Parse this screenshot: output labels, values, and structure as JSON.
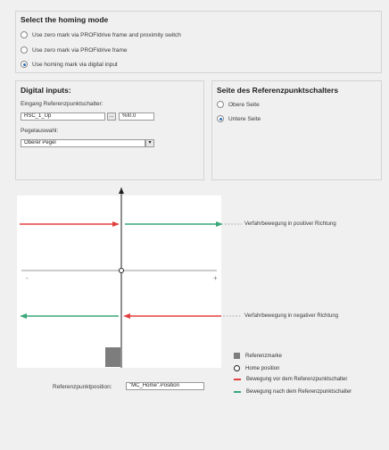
{
  "homing": {
    "title": "Select the homing mode",
    "options": [
      "Use zero mark via PROFIdrive frame and proximity switch",
      "Use zero mark via PROFIdrive frame",
      "Use homing mark via digital input"
    ],
    "selected_index": 2
  },
  "digital_inputs": {
    "title": "Digital inputs:",
    "ref_switch_label": "Eingang Referenzpunktschalter:",
    "ref_switch_value": "HSC_1_Up",
    "ref_switch_button": "…",
    "address_value": "%I0.0",
    "level_label": "Pegelauswahl:",
    "level_value": "Oberer Pegel"
  },
  "side": {
    "title": "Seite des Referenzpunktschalters",
    "options": [
      "Obere Seite",
      "Untere Seite"
    ],
    "selected_index": 1
  },
  "diagram": {
    "positive_label": "Verfahrbewegung in positiver Richtung",
    "negative_label": "Verfahrbewegung in negativer Richtung",
    "axis_minus": "-",
    "axis_plus": "+",
    "position_label": "Referenzpunktposition:",
    "position_value": "\"MC_Home\".Position"
  },
  "legend": {
    "items": [
      {
        "label": "Referenzmarke"
      },
      {
        "label": "Home position"
      },
      {
        "label": "Bewegung vor dem Referenzpunktschalter"
      },
      {
        "label": "Bewegung nach dem Referenzpunktschalter"
      }
    ]
  },
  "colors": {
    "red": "#e0403e",
    "green": "#3aa77a",
    "mark": "#7d7d7d",
    "selected": "#2b6fb3"
  }
}
